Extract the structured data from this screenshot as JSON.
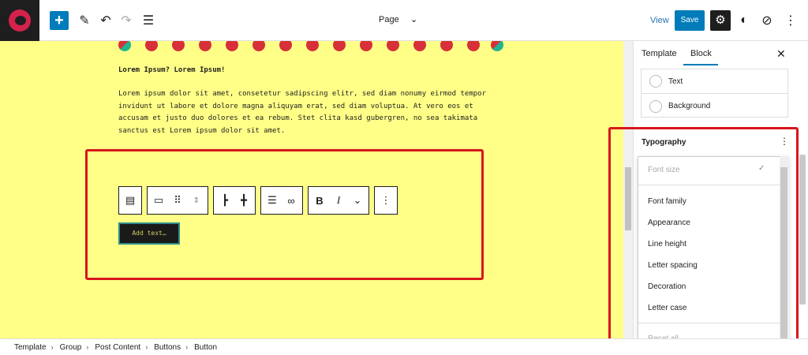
{
  "topbar": {
    "page_title": "Page",
    "view_label": "View",
    "save_label": "Save"
  },
  "content": {
    "heading": "Lorem Ipsum? Lorem Ipsum!",
    "paragraph_lines": [
      "Lorem ipsum dolor sit amet, consetetur sadipscing elitr, sed diam nonumy eirmod tempor",
      "invidunt ut labore et dolore magna aliquyam erat, sed diam voluptua. At vero eos et",
      "accusam et justo duo dolores et ea rebum. Stet clita kasd gubergren, no sea takimata",
      "sanctus est Lorem ipsum dolor sit amet."
    ],
    "button_placeholder": "Add text…"
  },
  "sidebar": {
    "tabs": [
      "Template",
      "Block"
    ],
    "active_tab": "Block",
    "color_items": [
      "Text",
      "Background"
    ],
    "typography_title": "Typography",
    "dropdown_items": [
      "Font size",
      "Font family",
      "Appearance",
      "Line height",
      "Letter spacing",
      "Decoration",
      "Letter case"
    ],
    "reset_label": "Reset all"
  },
  "breadcrumb": [
    "Template",
    "Group",
    "Post Content",
    "Buttons",
    "Button"
  ],
  "colors": {
    "accent": "#007cba",
    "canvas_bg": "#ffff88",
    "highlight_red": "#d7161d",
    "dot_red": "#d7303a",
    "dot_green": "#20b591"
  }
}
